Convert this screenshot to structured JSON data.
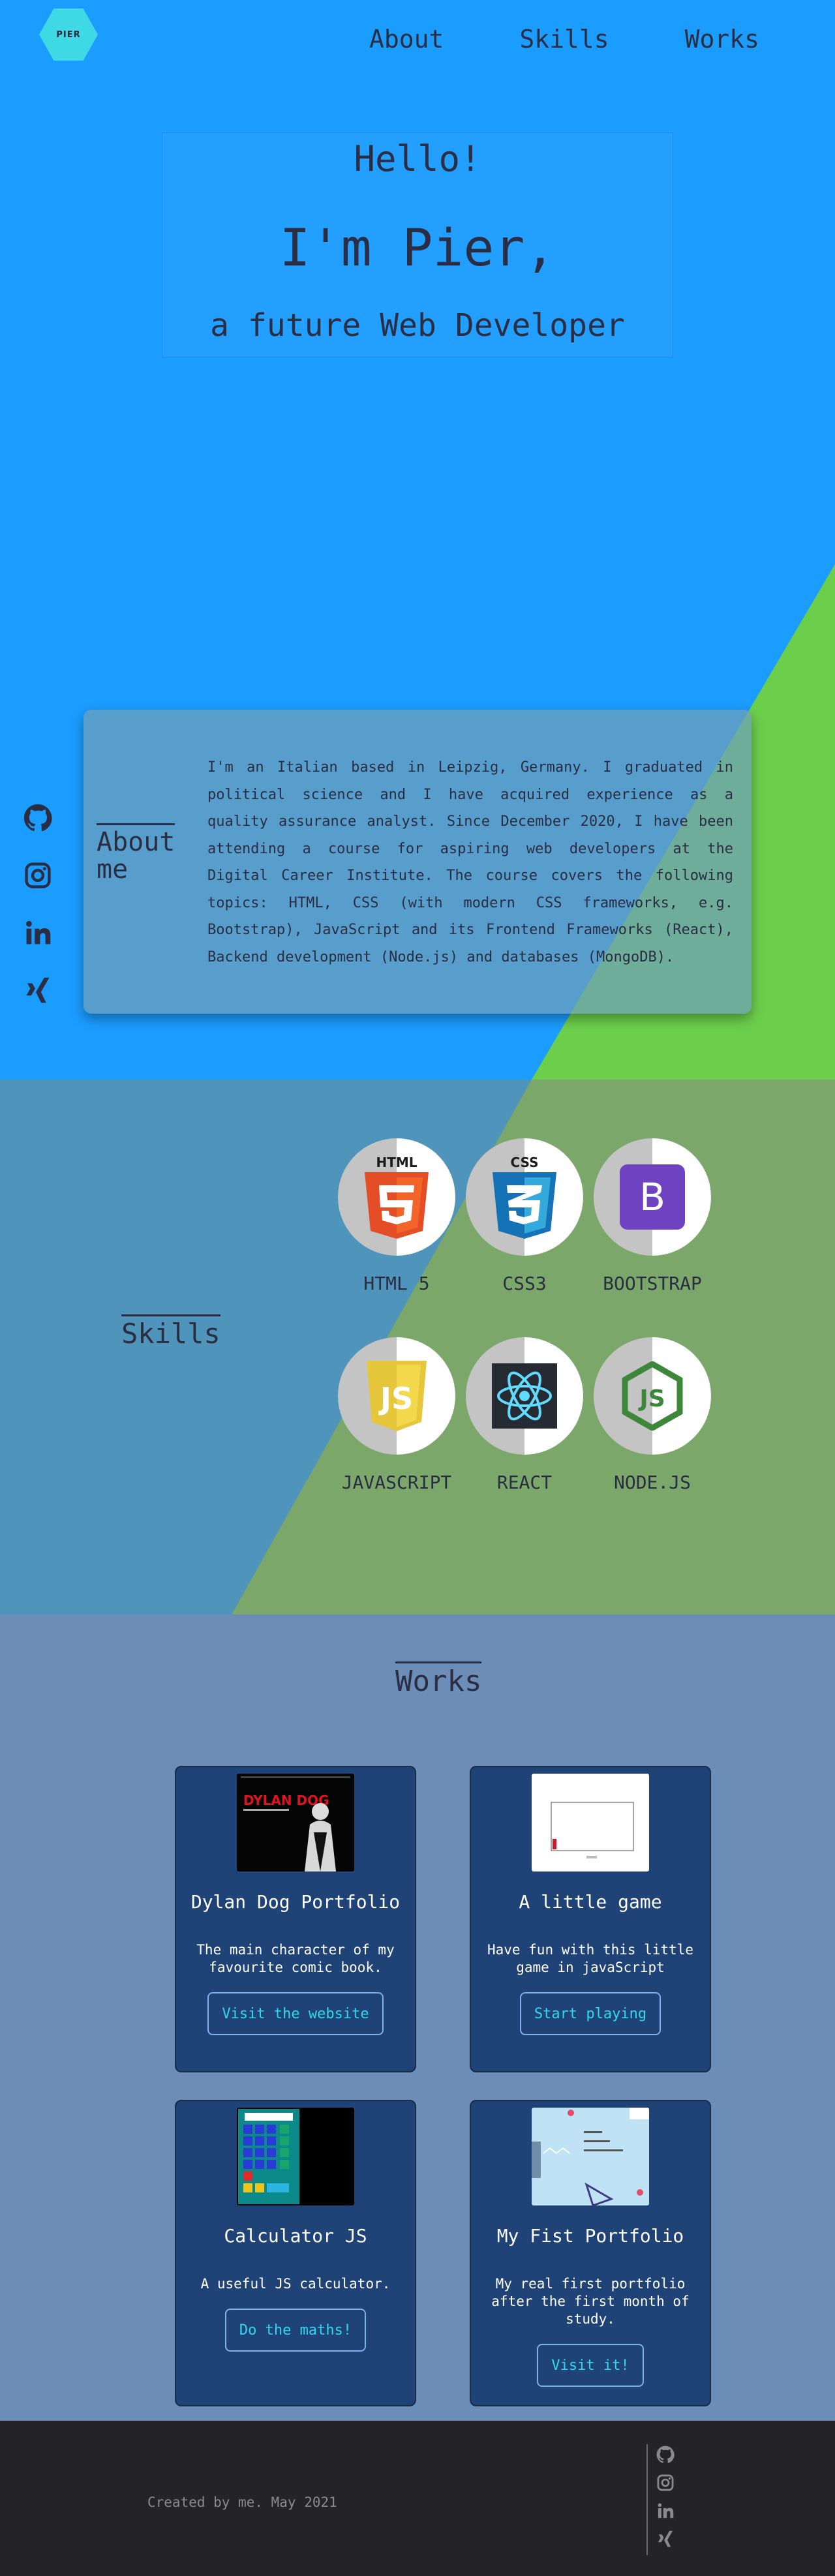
{
  "nav": {
    "logo": "PIER",
    "links": [
      "About",
      "Skills",
      "Works"
    ]
  },
  "hero": {
    "greeting": "Hello!",
    "name": "I'm Pier,",
    "subtitle": "a future Web Developer"
  },
  "socials": [
    "github-icon",
    "instagram-icon",
    "linkedin-icon",
    "xing-icon"
  ],
  "about": {
    "title": "About me",
    "text": "I'm an Italian based in Leipzig, Germany. I graduated in political science and I have acquired experience as a quality assurance analyst. Since December 2020, I have been attending a course for aspiring web developers at the Digital Career Institute. The course covers the following topics: HTML, CSS (with modern CSS frameworks, e.g. Bootstrap), JavaScript and its Frontend Frameworks (React), Backend development (Node.js) and databases (MongoDB)."
  },
  "skills": {
    "title": "Skills",
    "items": [
      {
        "label": "HTML 5",
        "icon": "html5-icon"
      },
      {
        "label": "CSS3",
        "icon": "css3-icon"
      },
      {
        "label": "BOOTSTRAP",
        "icon": "bootstrap-icon"
      },
      {
        "label": "JAVASCRIPT",
        "icon": "javascript-icon"
      },
      {
        "label": "REACT",
        "icon": "react-icon"
      },
      {
        "label": "NODE.JS",
        "icon": "nodejs-icon"
      }
    ]
  },
  "works": {
    "title": "Works",
    "items": [
      {
        "title": "Dylan Dog Portfolio",
        "desc": "The main character of my favourite comic book.",
        "button": "Visit the website",
        "thumb_text": "DYLAN DOG"
      },
      {
        "title": "A little game",
        "desc": "Have fun with this little game in javaScript",
        "button": "Start playing"
      },
      {
        "title": "Calculator JS",
        "desc": "A useful JS calculator.",
        "button": "Do the maths!"
      },
      {
        "title": "My Fist Portfolio",
        "desc": "My real first portfolio after the first month of study.",
        "button": "Visit it!"
      }
    ]
  },
  "footer": {
    "text": "Created by me. May 2021"
  },
  "colors": {
    "hero_blue": "#1b9cff",
    "accent_green": "#6ccf4c",
    "card_navy": "#1f4277",
    "button_cyan": "#31d8f0",
    "footer_dark": "#242427"
  }
}
